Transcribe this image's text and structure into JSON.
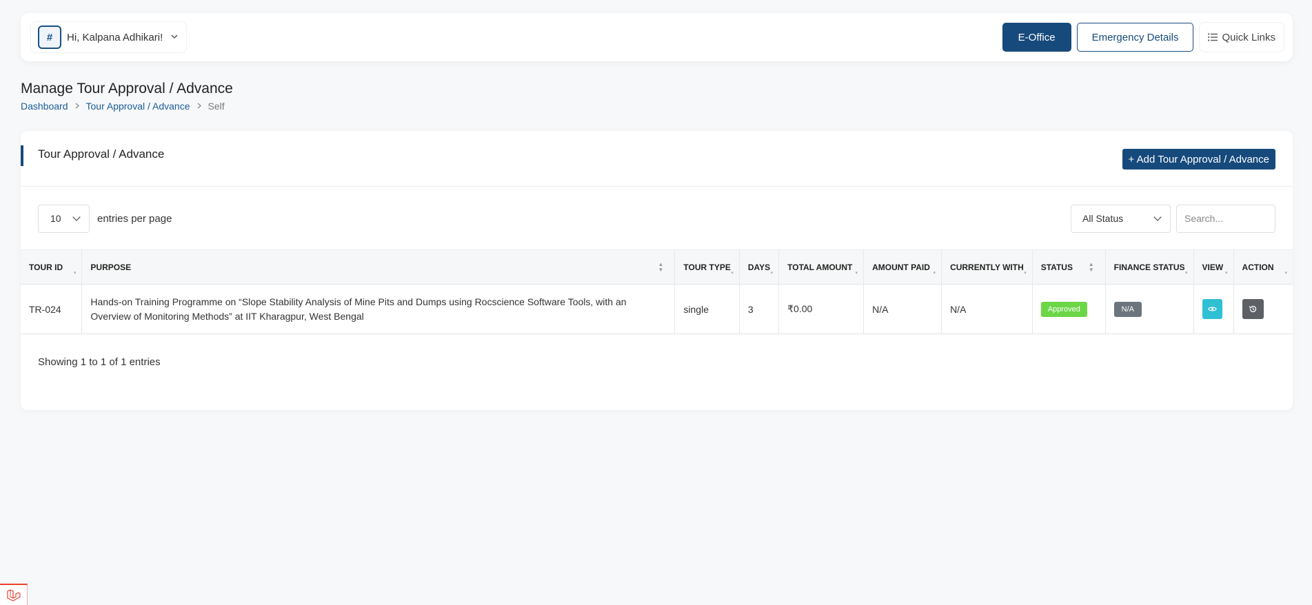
{
  "header": {
    "avatar_glyph": "#",
    "greeting": "Hi, Kalpana Adhikari!",
    "eoffice_label": "E-Office",
    "emergency_label": "Emergency Details",
    "quicklinks_label": "Quick Links"
  },
  "page": {
    "title": "Manage Tour Approval / Advance",
    "breadcrumb": [
      "Dashboard",
      "Tour Approval / Advance",
      "Self"
    ]
  },
  "card": {
    "title": "Tour Approval / Advance",
    "add_label": "+ Add Tour Approval / Advance",
    "entries_value": "10",
    "entries_label": "entries per page",
    "status_filter": "All Status",
    "search_placeholder": "Search...",
    "footer": "Showing 1 to 1 of 1 entries"
  },
  "table": {
    "columns": [
      "TOUR ID",
      "PURPOSE",
      "TOUR TYPE",
      "DAYS",
      "TOTAL AMOUNT",
      "AMOUNT PAID",
      "CURRENTLY WITH",
      "STATUS",
      "FINANCE STATUS",
      "VIEW",
      "ACTION"
    ],
    "rows": [
      {
        "tour_id": "TR-024",
        "purpose": "Hands-on Training Programme on “Slope Stability Analysis of Mine Pits and Dumps using Rocscience Software Tools, with an Overview of Monitoring Methods” at IIT Kharagpur, West Bengal",
        "tour_type": "single",
        "days": "3",
        "total_amount": "₹0.00",
        "amount_paid": "N/A",
        "currently_with": "N/A",
        "status": "Approved",
        "finance_status": "N/A"
      }
    ]
  },
  "icons": {
    "view": "eye-icon",
    "action": "history-icon",
    "quicklinks": "list-icon",
    "corner": "laravel-logo-icon"
  },
  "colors": {
    "primary": "#174a7c",
    "approved": "#6cd646",
    "view_button": "#2fc0d3",
    "na_badge": "#6c757d"
  }
}
